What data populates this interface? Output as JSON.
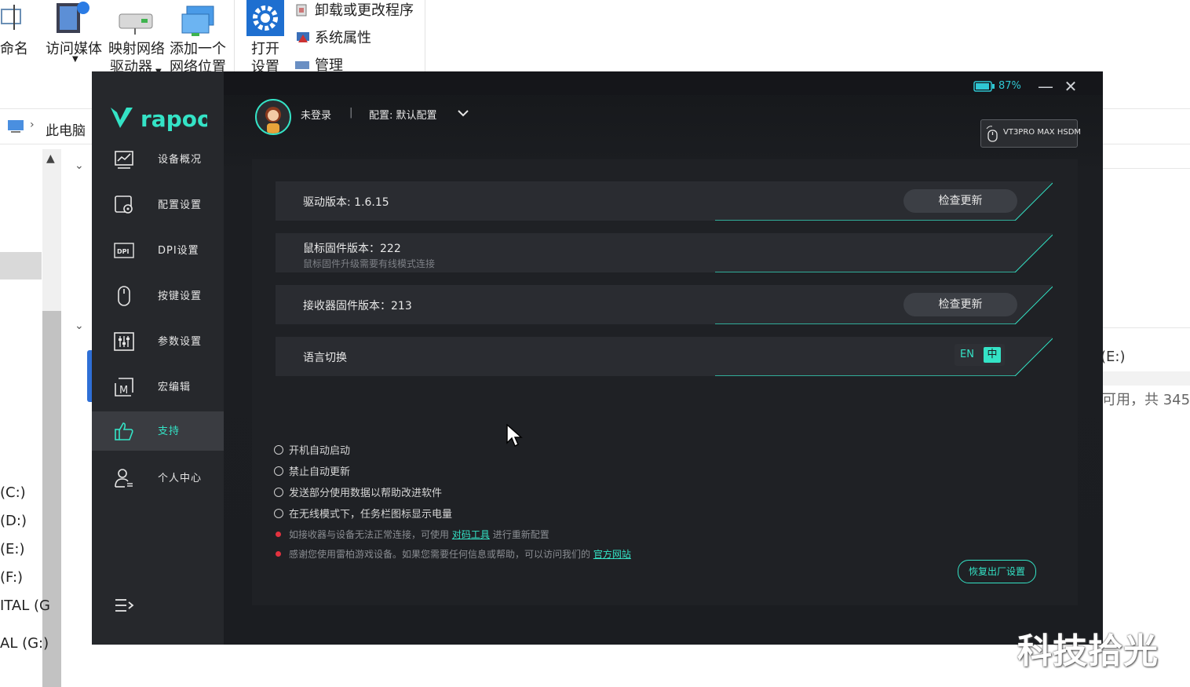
{
  "explorer": {
    "ribbon": {
      "rename": "命名",
      "access_media": "访问媒体",
      "map_drive_1": "映射网络",
      "map_drive_2": "驱动器",
      "add_location_1": "添加一个",
      "add_location_2": "网络位置",
      "open_settings_1": "打开",
      "open_settings_2": "设置",
      "uninstall": "卸载或更改程序",
      "system_props": "系统属性",
      "manage": "管理"
    },
    "address": "此电脑",
    "drives": [
      "(C:)",
      "(D:)",
      "(E:)",
      "(F:)",
      "ITAL (G",
      "AL (G:)"
    ],
    "right_pane": {
      "drive_label": "(E:)",
      "free_space": "可用，共 345"
    }
  },
  "app": {
    "brand": "rapoo",
    "battery": "87%",
    "user": "未登录",
    "separator": "|",
    "profile": "配置: 默认配置",
    "device": "VT3PRO MAX HSDM",
    "nav": [
      {
        "label": "设备概况",
        "icon": "device-overview-icon"
      },
      {
        "label": "配置设置",
        "icon": "config-settings-icon"
      },
      {
        "label": "DPI设置",
        "icon": "dpi-icon"
      },
      {
        "label": "按键设置",
        "icon": "mouse-button-icon"
      },
      {
        "label": "参数设置",
        "icon": "sliders-icon"
      },
      {
        "label": "宏编辑",
        "icon": "macro-icon"
      },
      {
        "label": "支持",
        "icon": "thumbs-up-icon"
      },
      {
        "label": "个人中心",
        "icon": "user-center-icon"
      }
    ],
    "rows": {
      "driver_version": "驱动版本: 1.6.15",
      "mouse_fw": "鼠标固件版本：222",
      "mouse_fw_note": "鼠标固件升级需要有线模式连接",
      "receiver_fw": "接收器固件版本：213",
      "language": "语言切换",
      "check_update": "检查更新",
      "lang_en": "EN",
      "lang_zh": "中"
    },
    "options": [
      "开机自动启动",
      "禁止自动更新",
      "发送部分使用数据以帮助改进软件",
      "在无线模式下，任务栏图标显示电量"
    ],
    "notes": {
      "pair_prefix": "如接收器与设备无法正常连接，可使用",
      "pair_link": "对码工具",
      "pair_suffix": "进行重新配置",
      "thanks_prefix": "感谢您使用雷柏游戏设备。如果您需要任何信息或帮助，可以访问我们的",
      "thanks_link": "官方网站"
    },
    "reset": "恢复出厂设置",
    "accent": "#34e3c6"
  },
  "watermark": "科技拾光"
}
